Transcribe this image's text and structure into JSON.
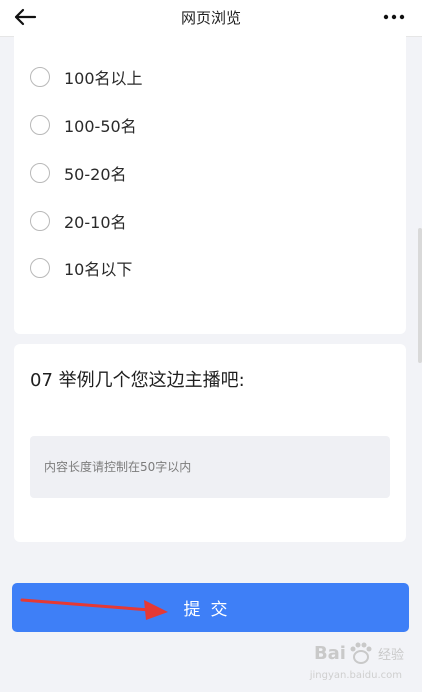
{
  "header": {
    "title": "网页浏览",
    "back_icon": "arrow-left-icon",
    "more_icon": "more-horizontal-icon"
  },
  "options": [
    {
      "label": "100名以上"
    },
    {
      "label": "100-50名"
    },
    {
      "label": "50-20名"
    },
    {
      "label": "20-10名"
    },
    {
      "label": "10名以下"
    }
  ],
  "question": {
    "text": "07 举例几个您这边主播吧:",
    "placeholder": "内容长度请控制在50字以内",
    "value": ""
  },
  "submit": {
    "label": "提交"
  },
  "watermark": {
    "brand": "Bai",
    "brand2": "经验",
    "domain": "jingyan.baidu.com"
  },
  "colors": {
    "accent": "#3e7ff7",
    "annotation_arrow": "#e53935",
    "background": "#f2f3f7"
  }
}
